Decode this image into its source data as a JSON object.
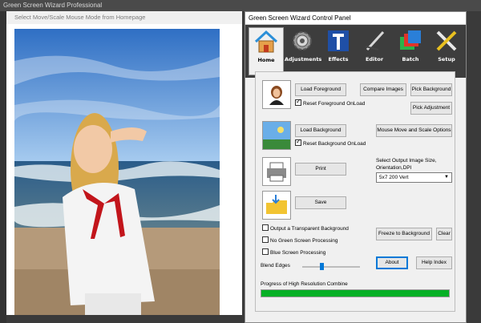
{
  "app": {
    "title": "Green Screen Wizard Professional",
    "photo_header": "Select Move/Scale Mouse Mode from Homepage"
  },
  "panel": {
    "title": "Green Screen Wizard Control Panel",
    "toolbar": [
      {
        "label": "Home",
        "icon": "house-icon",
        "active": true
      },
      {
        "label": "Adjustments",
        "icon": "gear-icon",
        "active": false
      },
      {
        "label": "Effects",
        "icon": "effects-letter-icon",
        "active": false
      },
      {
        "label": "Editor",
        "icon": "paintbrush-icon",
        "active": false
      },
      {
        "label": "Batch",
        "icon": "stacked-images-icon",
        "active": false
      },
      {
        "label": "Setup",
        "icon": "wrench-screwdriver-icon",
        "active": false
      }
    ],
    "buttons": {
      "load_foreground": "Load Foreground",
      "compare_images": "Compare Images",
      "pick_background": "Pick Background",
      "pick_adjustment": "Pick Adjustment",
      "load_background": "Load Background",
      "mouse_move": "Mouse Move and Scale Options",
      "print": "Print",
      "save": "Save",
      "freeze": "Freeze to Background",
      "clear": "Clear",
      "about": "About",
      "help_index": "Help Index"
    },
    "checkboxes": {
      "reset_foreground": {
        "label": "Reset Foreground OnLoad",
        "checked": true
      },
      "reset_background": {
        "label": "Reset Background OnLoad",
        "checked": true
      },
      "transparent_bg": {
        "label": "Output a Transparent Background",
        "checked": false
      },
      "no_green": {
        "label": "No Green Screen Processing",
        "checked": false
      },
      "blue_screen": {
        "label": "Blue Screen Processing",
        "checked": false
      }
    },
    "output_size_label_line1": "Select Output Image Size,",
    "output_size_label_line2": "Orientation,DPI",
    "output_size_value": "5x7 200 Vert",
    "blend_edges_label": "Blend Edges",
    "blend_edges_value": 0.33,
    "progress_label": "Progress of High Resolution Combine",
    "progress_value": 1.0
  },
  "colors": {
    "progress": "#06b025",
    "accent": "#0078d7"
  }
}
